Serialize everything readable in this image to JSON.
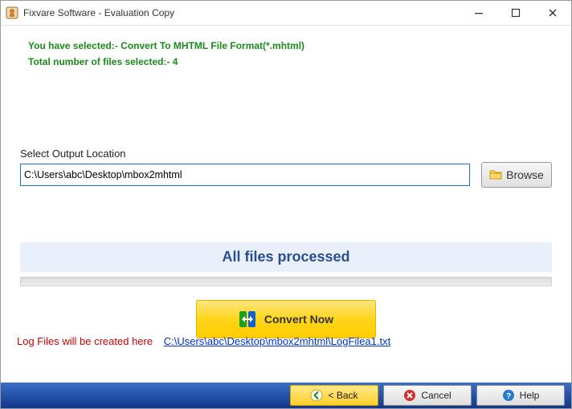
{
  "titlebar": {
    "title": "Fixvare Software - Evaluation Copy"
  },
  "info": {
    "selected_format_line": "You have selected:- Convert To MHTML File Format(*.mhtml)",
    "file_count_line": "Total number of files selected:- 4"
  },
  "output": {
    "label": "Select Output Location",
    "path_value": "C:\\Users\\abc\\Desktop\\mbox2mhtml",
    "browse_label": "Browse"
  },
  "status": {
    "message": "All files processed"
  },
  "actions": {
    "convert_label": "Convert Now"
  },
  "log": {
    "label": "Log Files will be created here",
    "link_text": "C:\\Users\\abc\\Desktop\\mbox2mhtml\\LogFilea1.txt"
  },
  "footer": {
    "back_label": "< Back",
    "cancel_label": "Cancel",
    "help_label": "Help"
  }
}
